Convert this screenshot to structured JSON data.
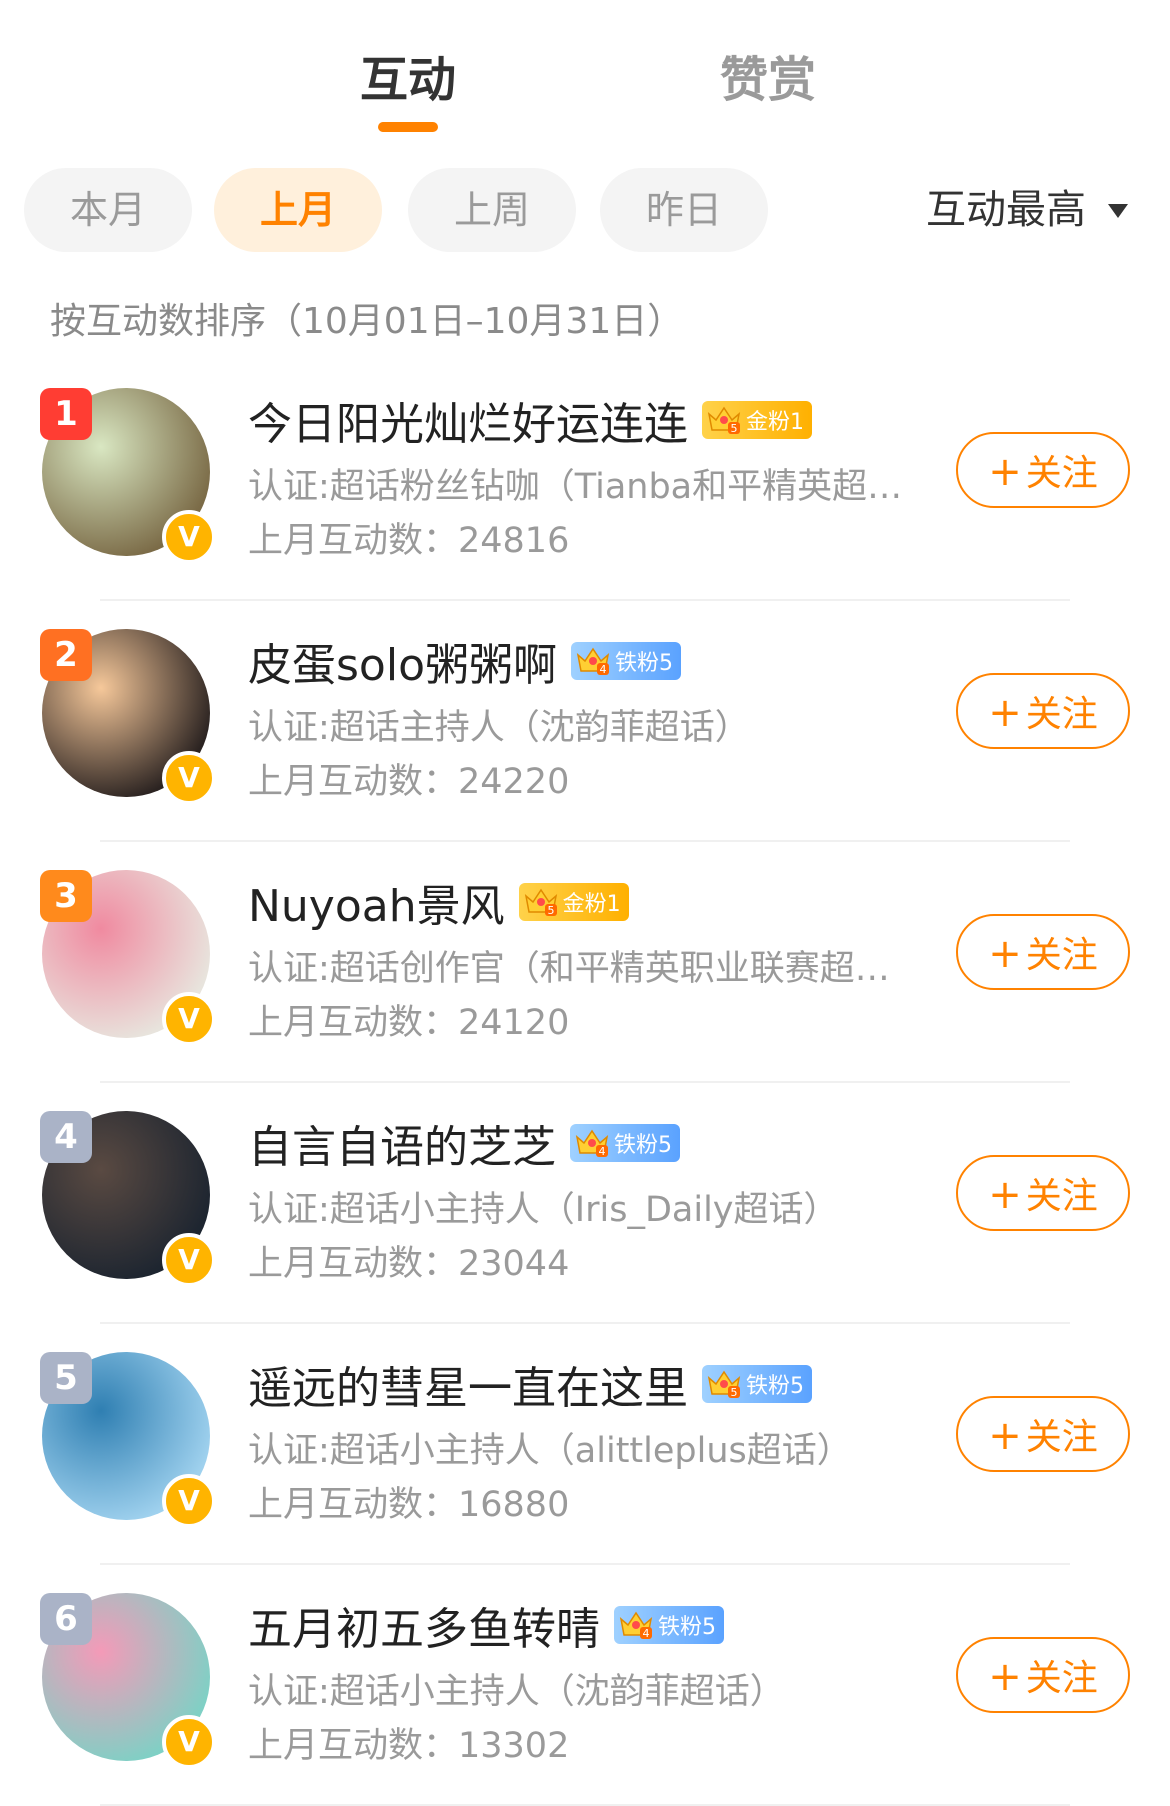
{
  "tabs": {
    "active": "互动",
    "inactive": "赞赏"
  },
  "filters": {
    "chips": [
      "本月",
      "上月",
      "上周",
      "昨日"
    ],
    "active_index": 1,
    "sort_label": "互动最高"
  },
  "range_text": "按互动数排序（10月01日–10月31日）",
  "follow_label": "关注",
  "rows": [
    {
      "rank": "1",
      "name": "今日阳光灿烂好运连连",
      "fan": "金粉1",
      "fan_type": "gold",
      "fan_level": "5",
      "cert": "认证:超话粉丝钻咖（Tianba和平精英超…",
      "count": "上月互动数：24816",
      "avatar_colors": [
        "#7b6b47",
        "#d9e7c2"
      ]
    },
    {
      "rank": "2",
      "name": "皮蛋solo粥粥啊",
      "fan": "铁粉5",
      "fan_type": "iron",
      "fan_level": "4",
      "cert": "认证:超话主持人（沈韵菲超话）",
      "count": "上月互动数：24220",
      "avatar_colors": [
        "#2b2321",
        "#f6c89a"
      ]
    },
    {
      "rank": "3",
      "name": "Nuyoah景风",
      "fan": "金粉1",
      "fan_type": "gold",
      "fan_level": "5",
      "cert": "认证:超话创作官（和平精英职业联赛超…",
      "count": "上月互动数：24120",
      "avatar_colors": [
        "#e8e4dd",
        "#f08aa0"
      ]
    },
    {
      "rank": "4",
      "name": "自言自语的芝芝",
      "fan": "铁粉5",
      "fan_type": "iron",
      "fan_level": "4",
      "cert": "认证:超话小主持人（Iris_Daily超话）",
      "count": "上月互动数：23044",
      "avatar_colors": [
        "#1d2530",
        "#5a4a42"
      ]
    },
    {
      "rank": "5",
      "name": "遥远的彗星一直在这里",
      "fan": "铁粉5",
      "fan_type": "iron",
      "fan_level": "5",
      "cert": "认证:超话小主持人（alittleplus超话）",
      "count": "上月互动数：16880",
      "avatar_colors": [
        "#9fd1ee",
        "#2f7fb2"
      ]
    },
    {
      "rank": "6",
      "name": "五月初五多鱼转晴",
      "fan": "铁粉5",
      "fan_type": "iron",
      "fan_level": "4",
      "cert": "认证:超话小主持人（沈韵菲超话）",
      "count": "上月互动数：13302",
      "avatar_colors": [
        "#7fd0c5",
        "#f49ab8"
      ]
    }
  ]
}
